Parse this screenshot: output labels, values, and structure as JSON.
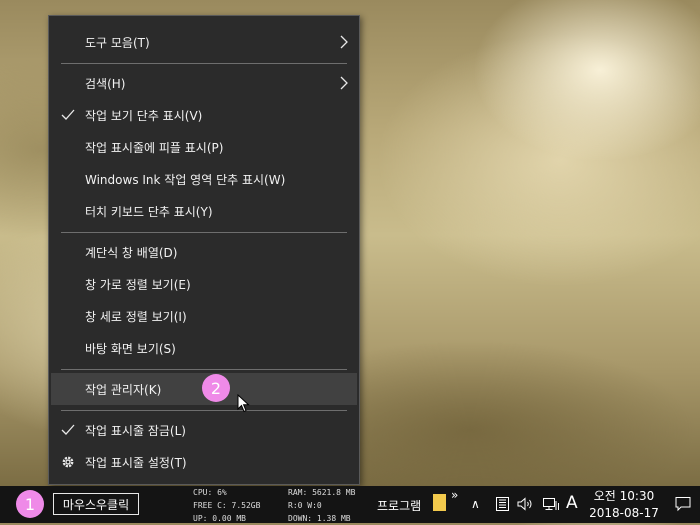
{
  "context_menu": {
    "items": [
      {
        "label": "도구 모음(T)",
        "submenu": true,
        "checked": false
      },
      {
        "label": "검색(H)",
        "submenu": true,
        "checked": false
      },
      {
        "label": "작업 보기 단추 표시(V)",
        "checked": true
      },
      {
        "label": "작업 표시줄에 피플 표시(P)",
        "checked": false
      },
      {
        "label": "Windows Ink 작업 영역 단추 표시(W)",
        "checked": false
      },
      {
        "label": "터치 키보드 단추 표시(Y)",
        "checked": false
      },
      {
        "label": "계단식 창 배열(D)",
        "checked": false
      },
      {
        "label": "창 가로 정렬 보기(E)",
        "checked": false
      },
      {
        "label": "창 세로 정렬 보기(I)",
        "checked": false
      },
      {
        "label": "바탕 화면 보기(S)",
        "checked": false
      },
      {
        "label": "작업 관리자(K)",
        "checked": false,
        "hovered": true
      },
      {
        "label": "작업 표시줄 잠금(L)",
        "checked": true
      },
      {
        "label": "작업 표시줄 설정(T)",
        "icon": "gear-icon"
      }
    ]
  },
  "annotations": {
    "step1": "1",
    "step2": "2",
    "color": "#ef8ae8"
  },
  "taskbar": {
    "button_label": "마우스우클릭",
    "monitor": {
      "cpu": "CPU:  6%",
      "free": "FREE C: 7.52GB",
      "up": "UP: 0.00 MB",
      "ram": "RAM: 5621.8 MB",
      "rw": "R:0 W:0",
      "down": "DOWN: 1.38 MB"
    },
    "programs_label": "프로그램",
    "overflow": "»",
    "tray_chevron": "∧",
    "ime": "A",
    "clock_time": "오전 10:30",
    "clock_date": "2018-08-17"
  },
  "colors": {
    "menu_bg": "#2b2b2b",
    "menu_hover": "#414141",
    "taskbar_bg": "#141414",
    "folder": "#f2c94c"
  }
}
